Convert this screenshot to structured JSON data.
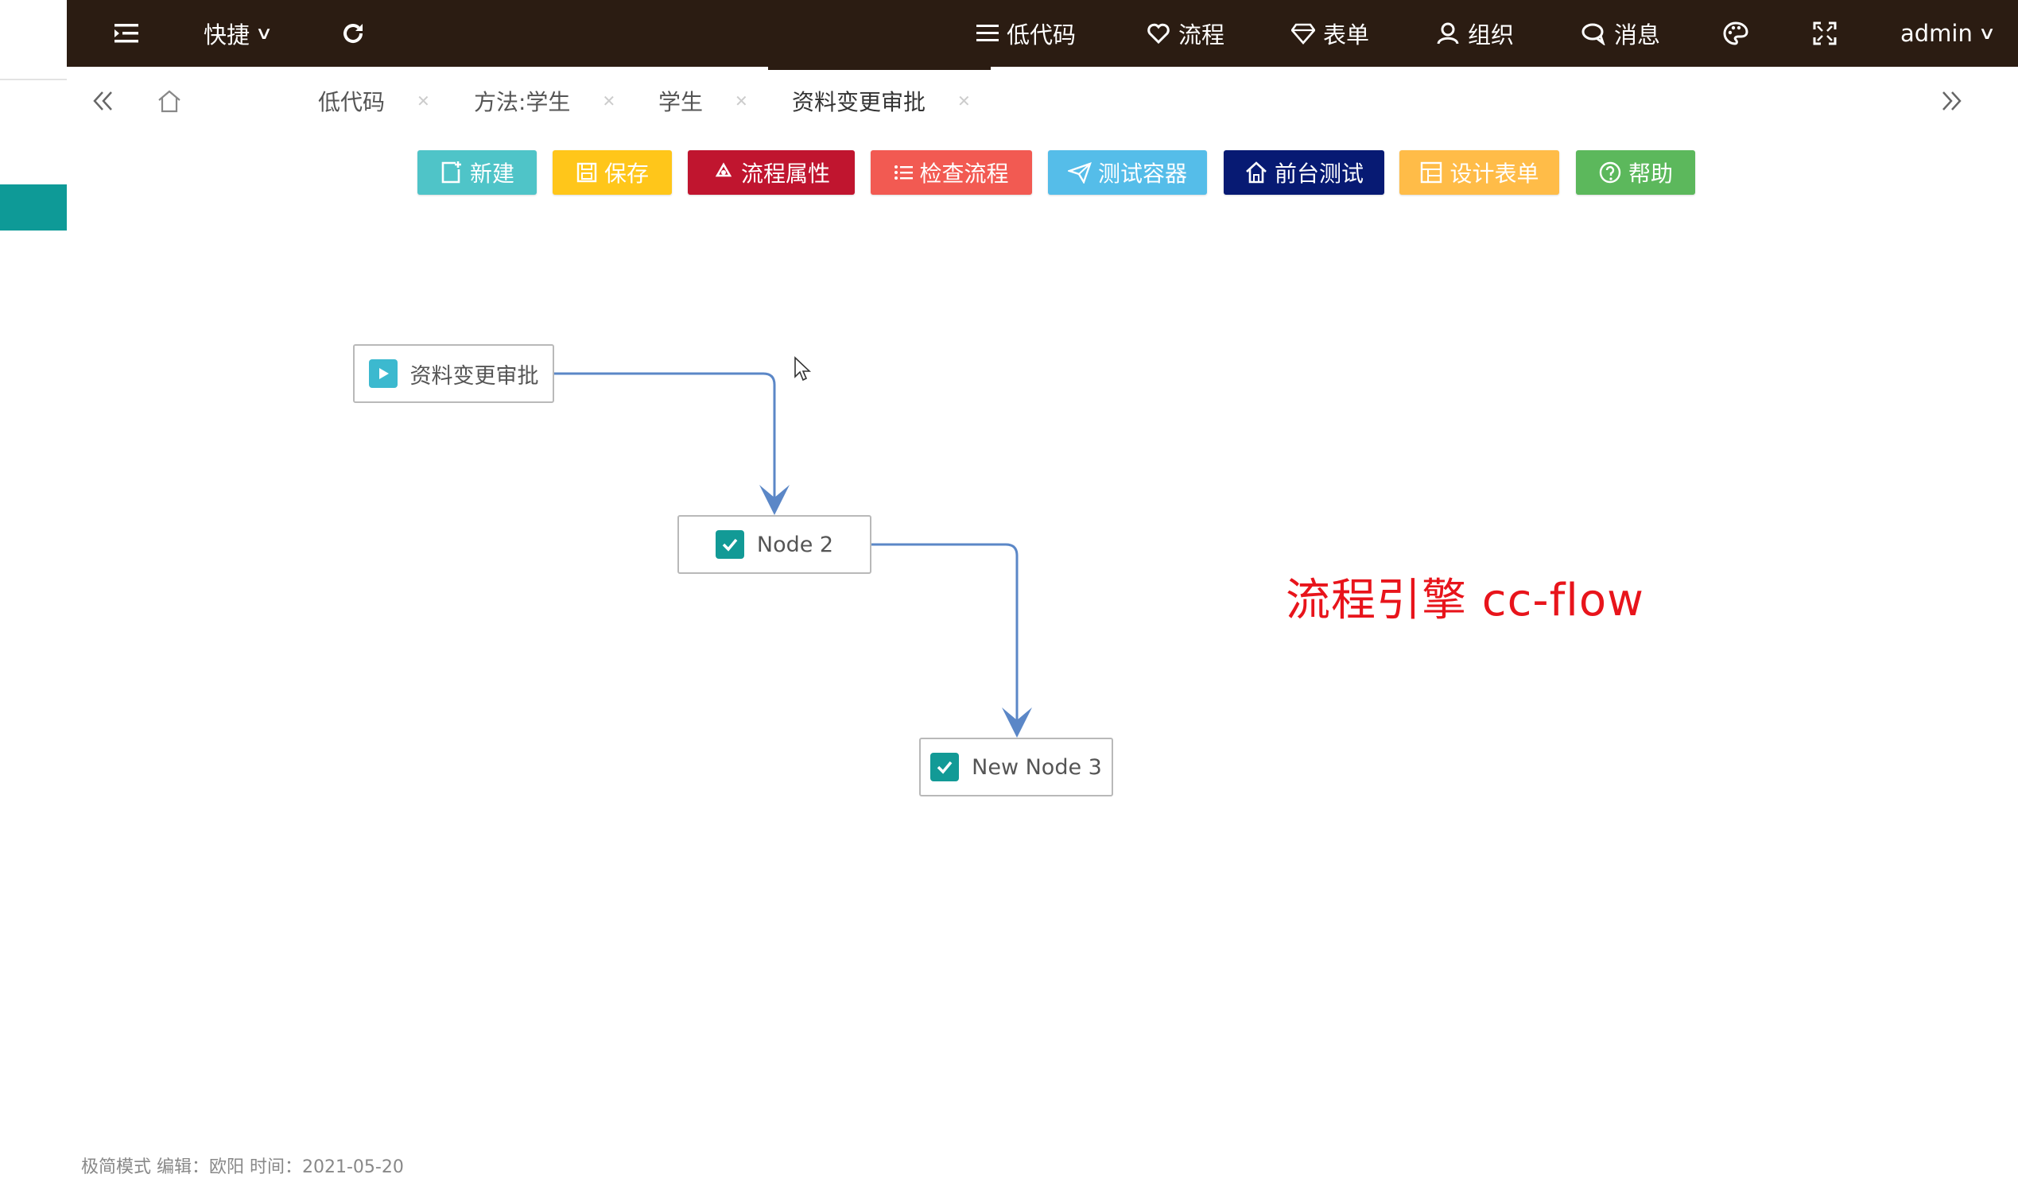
{
  "topbar": {
    "shortcut_label": "快捷",
    "menu": [
      {
        "label": "低代码",
        "icon": "list-icon"
      },
      {
        "label": "流程",
        "icon": "heart-icon"
      },
      {
        "label": "表单",
        "icon": "diamond-icon"
      },
      {
        "label": "组织",
        "icon": "user-icon"
      },
      {
        "label": "消息",
        "icon": "chat-icon"
      }
    ],
    "user_label": "admin",
    "colors": {
      "bar": "#2b1c12",
      "text": "#ffffff"
    }
  },
  "tabs": [
    {
      "label": "低代码",
      "active": false
    },
    {
      "label": "方法:学生",
      "active": false
    },
    {
      "label": "学生",
      "active": false
    },
    {
      "label": "资料变更审批",
      "active": true
    }
  ],
  "toolbar": {
    "buttons": [
      {
        "label": "新建",
        "color": "#4fc4c8",
        "icon": "new-icon"
      },
      {
        "label": "保存",
        "color": "#ffc61a",
        "icon": "save-icon"
      },
      {
        "label": "流程属性",
        "color": "#c0152f",
        "icon": "recycle-icon"
      },
      {
        "label": "检查流程",
        "color": "#f25a52",
        "icon": "list-icon"
      },
      {
        "label": "测试容器",
        "color": "#55bde9",
        "icon": "send-icon"
      },
      {
        "label": "前台测试",
        "color": "#071a73",
        "icon": "home-icon"
      },
      {
        "label": "设计表单",
        "color": "#ffbc48",
        "icon": "form-icon"
      },
      {
        "label": "帮助",
        "color": "#5cb85c",
        "icon": "help-icon"
      }
    ]
  },
  "flow": {
    "nodes": [
      {
        "label": "资料变更审批",
        "kind": "start"
      },
      {
        "label": "Node 2",
        "kind": "task"
      },
      {
        "label": "New Node 3",
        "kind": "task"
      }
    ],
    "edges": [
      {
        "from": "资料变更审批",
        "to": "Node 2"
      },
      {
        "from": "Node 2",
        "to": "New Node 3"
      }
    ],
    "colors": {
      "edge": "#5b87c7",
      "start_icon": "#3cb9cf",
      "task_icon": "#129a96"
    }
  },
  "watermark": "流程引擎 cc-flow",
  "footer": "极简模式 编辑：欧阳 时间：2021-05-20"
}
